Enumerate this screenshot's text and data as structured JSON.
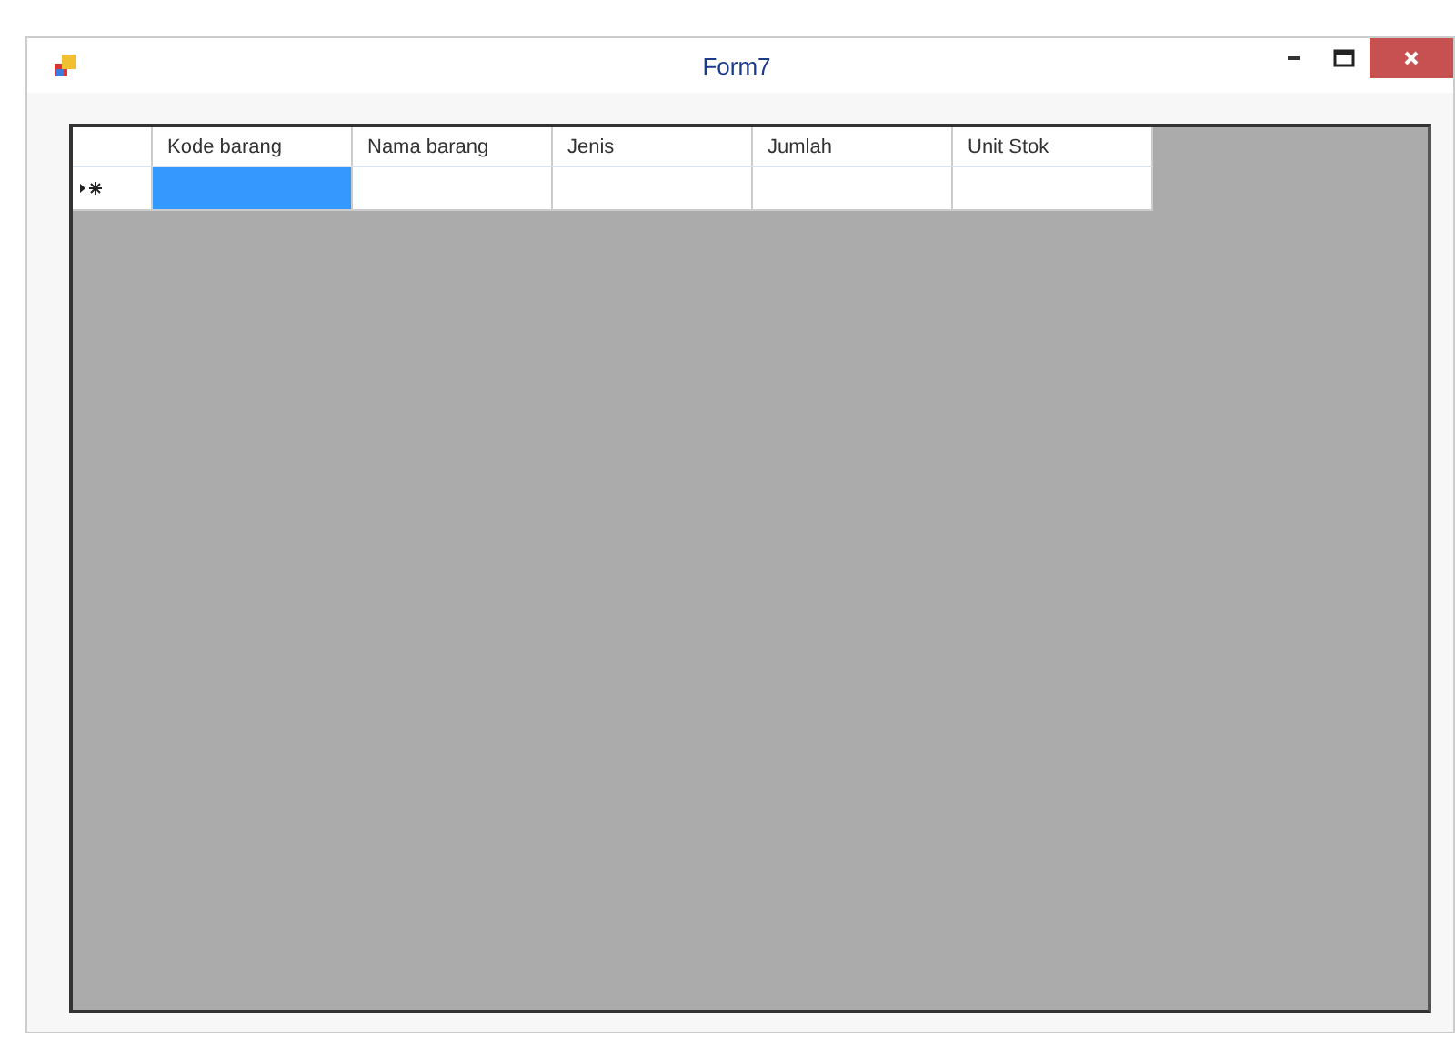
{
  "window": {
    "title": "Form7"
  },
  "grid": {
    "columns": [
      "Kode barang",
      "Nama barang",
      "Jenis",
      "Jumlah",
      "Unit Stok"
    ],
    "rows": [
      {
        "current": true,
        "cells": [
          {
            "selected": true
          },
          {
            "selected": false
          },
          {
            "selected": false
          },
          {
            "selected": false
          },
          {
            "selected": false
          }
        ]
      }
    ]
  }
}
